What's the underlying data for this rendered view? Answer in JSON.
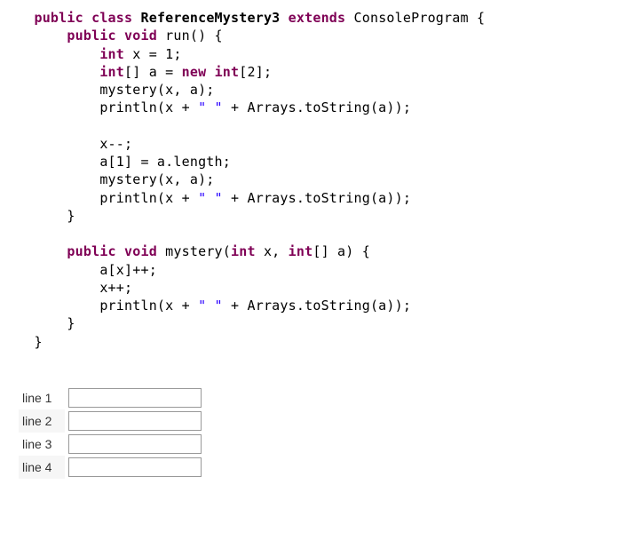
{
  "code": {
    "l1_kw1": "public class",
    "l1_name": " ReferenceMystery3 ",
    "l1_kw2": "extends",
    "l1_rest": " ConsoleProgram {",
    "l2_kw1": "public void",
    "l2_rest": " run() {",
    "l3_kw1": "int",
    "l3_rest": " x = 1;",
    "l4_kw1": "int",
    "l4_mid": "[] a = ",
    "l4_kw2": "new int",
    "l4_rest": "[2];",
    "l5_rest": "mystery(x, a);",
    "l6_part1": "println(x + ",
    "l6_str": "\" \"",
    "l6_part2": " + Arrays.toString(a));",
    "blank": "",
    "l8_rest": "x--;",
    "l9_rest": "a[1] = a.length;",
    "l10_rest": "mystery(x, a);",
    "l11_part1": "println(x + ",
    "l11_str": "\" \"",
    "l11_part2": " + Arrays.toString(a));",
    "l12_rest": "}",
    "l14_kw1": "public void",
    "l14_mid": " mystery(",
    "l14_kw2": "int",
    "l14_mid2": " x, ",
    "l14_kw3": "int",
    "l14_rest": "[] a) {",
    "l15_rest": "a[x]++;",
    "l16_rest": "x++;",
    "l17_part1": "println(x + ",
    "l17_str": "\" \"",
    "l17_part2": " + Arrays.toString(a));",
    "l18_rest": "}",
    "l19_rest": "}"
  },
  "answers": {
    "labels": [
      "line 1",
      "line 2",
      "line 3",
      "line 4"
    ],
    "values": [
      "",
      "",
      "",
      ""
    ]
  }
}
